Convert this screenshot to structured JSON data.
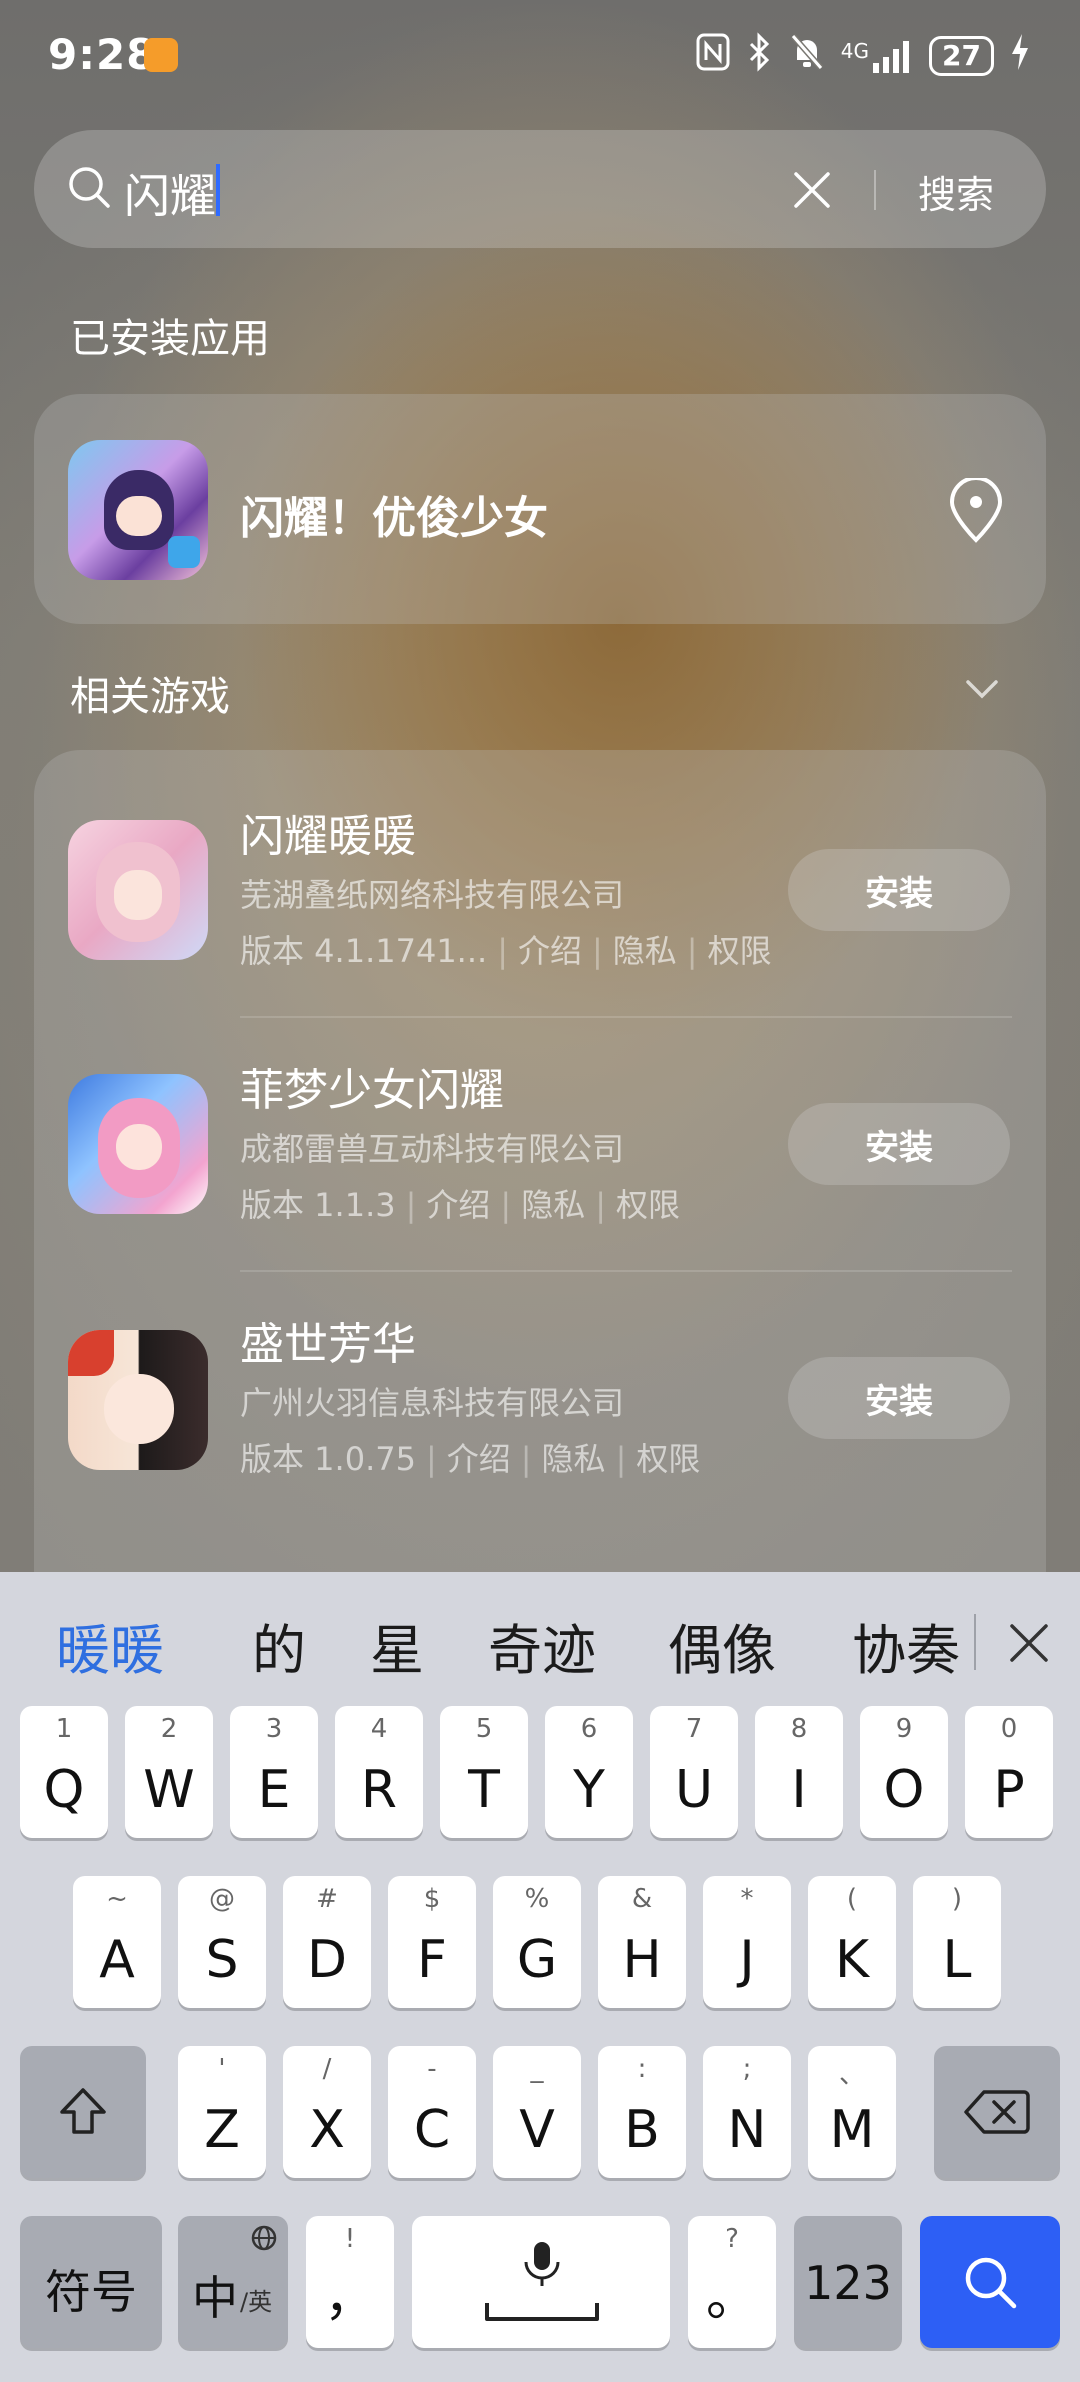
{
  "status_bar": {
    "time": "9:28",
    "network": "4G",
    "battery": "27"
  },
  "search": {
    "query": "闪耀",
    "button_label": "搜索"
  },
  "installed_section": {
    "title": "已安装应用",
    "app_name": "闪耀！优俊少女"
  },
  "related_section": {
    "title": "相关游戏",
    "items": [
      {
        "name": "闪耀暖暖",
        "developer": "芜湖叠纸网络科技有限公司",
        "version": "版本 4.1.1741...",
        "links": [
          "介绍",
          "隐私",
          "权限"
        ],
        "install_label": "安装"
      },
      {
        "name": "菲梦少女闪耀",
        "developer": "成都雷兽互动科技有限公司",
        "version": "版本 1.1.3",
        "links": [
          "介绍",
          "隐私",
          "权限"
        ],
        "install_label": "安装"
      },
      {
        "name": "盛世芳华",
        "developer": "广州火羽信息科技有限公司",
        "version": "版本 1.0.75",
        "links": [
          "介绍",
          "隐私",
          "权限"
        ],
        "install_label": "安装"
      }
    ]
  },
  "keyboard": {
    "candidates": [
      "暖暖",
      "的",
      "星",
      "奇迹",
      "偶像",
      "协奏"
    ],
    "row1": [
      {
        "main": "Q",
        "sub": "1"
      },
      {
        "main": "W",
        "sub": "2"
      },
      {
        "main": "E",
        "sub": "3"
      },
      {
        "main": "R",
        "sub": "4"
      },
      {
        "main": "T",
        "sub": "5"
      },
      {
        "main": "Y",
        "sub": "6"
      },
      {
        "main": "U",
        "sub": "7"
      },
      {
        "main": "I",
        "sub": "8"
      },
      {
        "main": "O",
        "sub": "9"
      },
      {
        "main": "P",
        "sub": "0"
      }
    ],
    "row2": [
      {
        "main": "A",
        "sub": "~"
      },
      {
        "main": "S",
        "sub": "@"
      },
      {
        "main": "D",
        "sub": "#"
      },
      {
        "main": "F",
        "sub": "$"
      },
      {
        "main": "G",
        "sub": "%"
      },
      {
        "main": "H",
        "sub": "&"
      },
      {
        "main": "J",
        "sub": "*"
      },
      {
        "main": "K",
        "sub": "("
      },
      {
        "main": "L",
        "sub": ")"
      }
    ],
    "row3": [
      {
        "main": "Z",
        "sub": "'"
      },
      {
        "main": "X",
        "sub": "/"
      },
      {
        "main": "C",
        "sub": "-"
      },
      {
        "main": "V",
        "sub": "_"
      },
      {
        "main": "B",
        "sub": ":"
      },
      {
        "main": "N",
        "sub": ";"
      },
      {
        "main": "M",
        "sub": "、"
      }
    ],
    "symbols_label": "符号",
    "lang_label_main": "中",
    "lang_label_sub": "/英",
    "comma_main": "，",
    "comma_sub": "!",
    "period_main": "。",
    "period_sub": "?",
    "num_label": "123"
  },
  "colors": {
    "accent_blue": "#2d5ff5",
    "candidate_selected": "#2f6fe0",
    "app_badge_orange": "#f59c2a"
  }
}
